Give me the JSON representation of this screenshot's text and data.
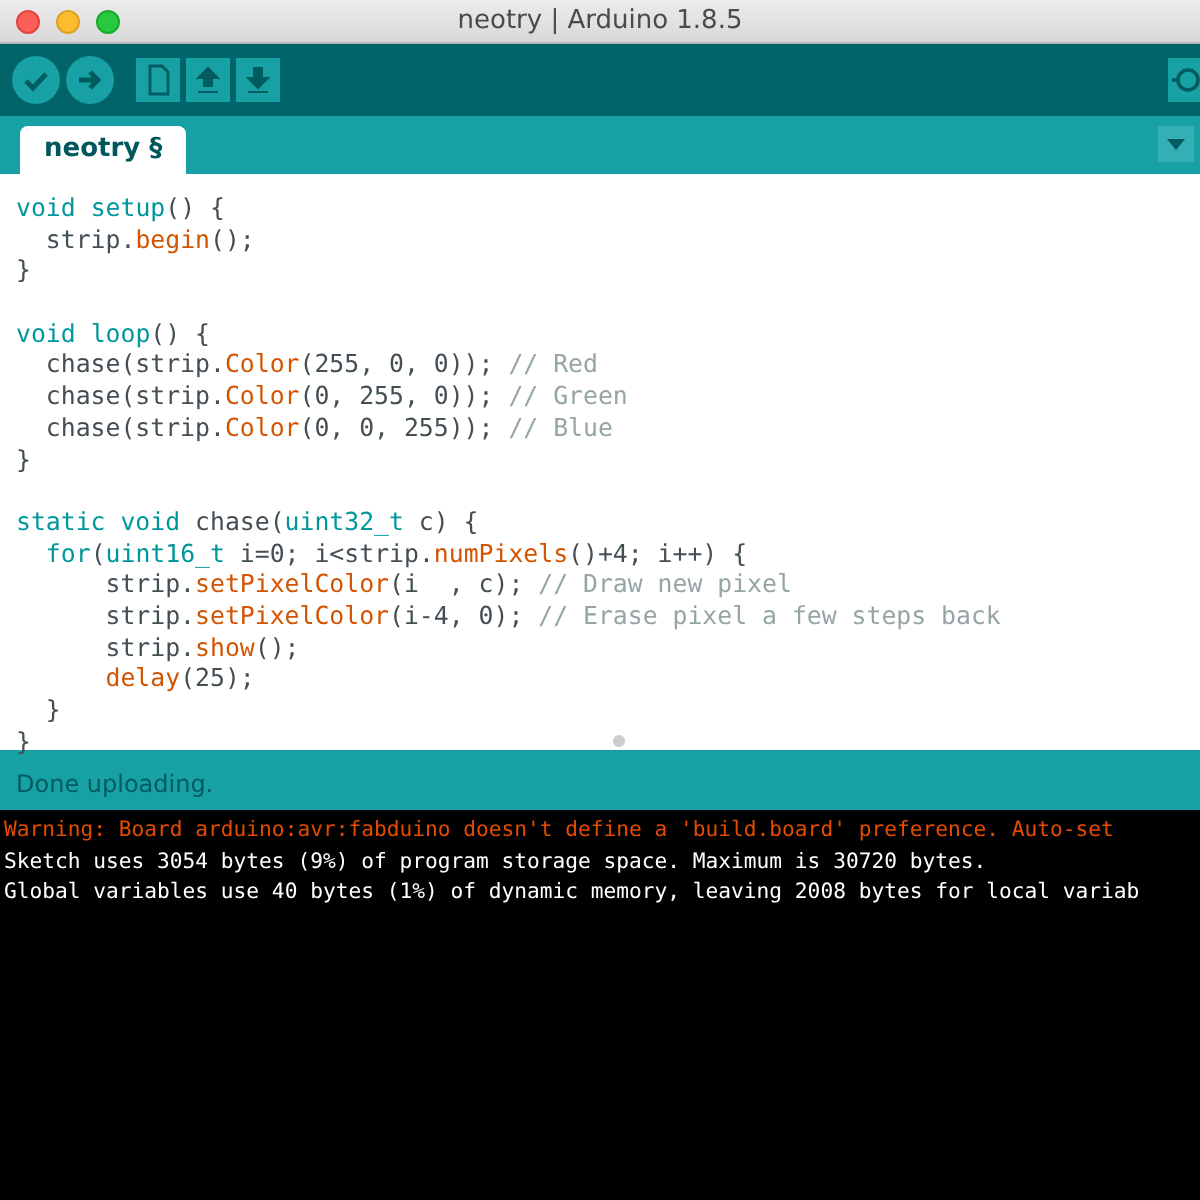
{
  "window": {
    "title": "neotry | Arduino 1.8.5"
  },
  "tabs": [
    {
      "label": "neotry §",
      "selected": true
    }
  ],
  "code_lines": [
    {
      "kind": "code",
      "segments": [
        {
          "text": "void ",
          "kind": "keyword"
        },
        {
          "text": "setup",
          "kind": "keyword"
        },
        {
          "text": "() {",
          "kind": "plain"
        }
      ]
    },
    {
      "kind": "code",
      "segments": [
        {
          "text": "  strip.",
          "kind": "plain"
        },
        {
          "text": "begin",
          "kind": "function"
        },
        {
          "text": "();",
          "kind": "plain"
        }
      ]
    },
    {
      "kind": "code",
      "segments": [
        {
          "text": "}",
          "kind": "plain"
        }
      ]
    },
    {
      "kind": "blank"
    },
    {
      "kind": "code",
      "segments": [
        {
          "text": "void ",
          "kind": "keyword"
        },
        {
          "text": "loop",
          "kind": "keyword"
        },
        {
          "text": "() {",
          "kind": "plain"
        }
      ]
    },
    {
      "kind": "code",
      "segments": [
        {
          "text": "  chase(strip.",
          "kind": "plain"
        },
        {
          "text": "Color",
          "kind": "function"
        },
        {
          "text": "(255, 0, 0)); ",
          "kind": "plain"
        },
        {
          "text": "// Red",
          "kind": "comment"
        }
      ]
    },
    {
      "kind": "code",
      "segments": [
        {
          "text": "  chase(strip.",
          "kind": "plain"
        },
        {
          "text": "Color",
          "kind": "function"
        },
        {
          "text": "(0, 255, 0)); ",
          "kind": "plain"
        },
        {
          "text": "// Green",
          "kind": "comment"
        }
      ]
    },
    {
      "kind": "code",
      "segments": [
        {
          "text": "  chase(strip.",
          "kind": "plain"
        },
        {
          "text": "Color",
          "kind": "function"
        },
        {
          "text": "(0, 0, 255)); ",
          "kind": "plain"
        },
        {
          "text": "// Blue",
          "kind": "comment"
        }
      ]
    },
    {
      "kind": "code",
      "segments": [
        {
          "text": "}",
          "kind": "plain"
        }
      ]
    },
    {
      "kind": "blank"
    },
    {
      "kind": "code",
      "segments": [
        {
          "text": "static void",
          "kind": "keyword"
        },
        {
          "text": " chase(",
          "kind": "plain"
        },
        {
          "text": "uint32_t",
          "kind": "keyword"
        },
        {
          "text": " c) {",
          "kind": "plain"
        }
      ]
    },
    {
      "kind": "code",
      "segments": [
        {
          "text": "  for",
          "kind": "keyword"
        },
        {
          "text": "(",
          "kind": "plain"
        },
        {
          "text": "uint16_t",
          "kind": "keyword"
        },
        {
          "text": " i=0; i<strip.",
          "kind": "plain"
        },
        {
          "text": "numPixels",
          "kind": "function"
        },
        {
          "text": "()+4; i++) {",
          "kind": "plain"
        }
      ]
    },
    {
      "kind": "code",
      "segments": [
        {
          "text": "      strip.",
          "kind": "plain"
        },
        {
          "text": "setPixelColor",
          "kind": "function"
        },
        {
          "text": "(i  , c); ",
          "kind": "plain"
        },
        {
          "text": "// Draw new pixel",
          "kind": "comment"
        }
      ]
    },
    {
      "kind": "code",
      "segments": [
        {
          "text": "      strip.",
          "kind": "plain"
        },
        {
          "text": "setPixelColor",
          "kind": "function"
        },
        {
          "text": "(i-4, 0); ",
          "kind": "plain"
        },
        {
          "text": "// Erase pixel a few steps back",
          "kind": "comment"
        }
      ]
    },
    {
      "kind": "code",
      "segments": [
        {
          "text": "      strip.",
          "kind": "plain"
        },
        {
          "text": "show",
          "kind": "function"
        },
        {
          "text": "();",
          "kind": "plain"
        }
      ]
    },
    {
      "kind": "code",
      "segments": [
        {
          "text": "      delay",
          "kind": "function"
        },
        {
          "text": "(25);",
          "kind": "plain"
        }
      ]
    },
    {
      "kind": "code",
      "segments": [
        {
          "text": "  }",
          "kind": "plain"
        }
      ]
    },
    {
      "kind": "code",
      "segments": [
        {
          "text": "}",
          "kind": "plain"
        }
      ]
    }
  ],
  "status_bar": "Done uploading.",
  "console_lines": [
    {
      "kind": "warning",
      "text": "Warning: Board arduino:avr:fabduino doesn't define a 'build.board' preference. Auto-set"
    },
    {
      "kind": "info",
      "text": "Sketch uses 3054 bytes (9%) of program storage space. Maximum is 30720 bytes."
    },
    {
      "kind": "info",
      "text": "Global variables use 40 bytes (1%) of dynamic memory, leaving 2008 bytes for local variab"
    }
  ]
}
